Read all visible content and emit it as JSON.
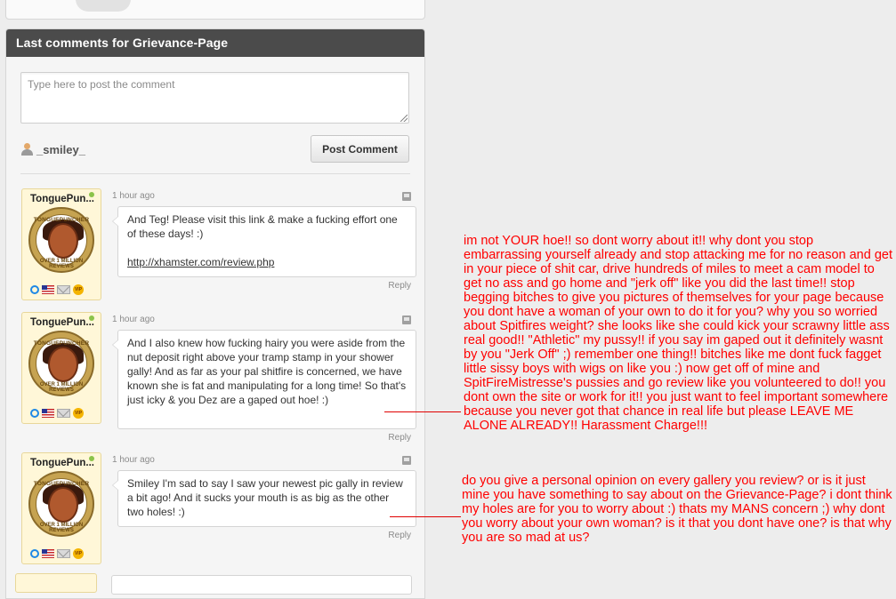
{
  "panel": {
    "title": "Last comments for Grievance-Page",
    "textarea_placeholder": "Type here to post the comment",
    "current_user": "_smiley_",
    "post_button": "Post Comment"
  },
  "badge": {
    "top_text": "TONGUEPUNCHER",
    "center_text": "XHAMSTER",
    "bottom_text": "OVER 1 MILLION REVIEWS",
    "vip_label": "VIP"
  },
  "comments": [
    {
      "username": "TonguePun...",
      "time": "1 hour ago",
      "text": "And Teg! Please visit this link & make a fucking effort one of these days! :)",
      "link": "http://xhamster.com/review.php",
      "reply": "Reply"
    },
    {
      "username": "TonguePun...",
      "time": "1 hour ago",
      "text": "And I also knew how fucking hairy you were aside from the nut deposit right above your tramp stamp in your shower gally! And as far as your pal shitfire is concerned, we have known she is fat and manipulating for a long time! So that's just icky & you Dez are a gaped out hoe! :)",
      "reply": "Reply"
    },
    {
      "username": "TonguePun...",
      "time": "1 hour ago",
      "text": "Smiley I'm sad to say I saw your newest pic gally in review a bit ago! And it sucks your mouth is as big as the other two holes! :)",
      "reply": "Reply"
    }
  ],
  "annotations": {
    "first": "im not YOUR hoe!! so dont worry about it!! why dont you stop embarrassing yourself already and stop attacking me for no reason and get in your piece of shit car, drive hundreds of miles to meet a cam model to get no ass and go home and \"jerk off\" like you did the last time!! stop begging bitches to give you pictures of themselves for your page because you dont have a woman of your own to do it for you? why you so worried about Spitfires weight? she looks like she could kick your scrawny little ass real good!! \"Athletic\" my pussy!! if you say im  gaped out it definitely  wasnt by you \"Jerk Off\"  ;) remember one thing!! bitches like me dont fuck fagget little sissy boys with wigs on like you :) now get off of mine and SpitFireMistresse's pussies and go review like you volunteered to do!! you dont own the site or work for it!! you just want to feel important somewhere because you never got that chance in real life but please LEAVE ME ALONE ALREADY!! Harassment Charge!!!",
    "second": "do you give a personal opinion on every gallery you review? or is it just mine you have something to say about on the Grievance-Page? i dont think my holes are for you to worry about :) thats my MANS concern ;) why dont you worry about your own woman? is it that you dont have one? is that why you are so mad at us?"
  },
  "colors": {
    "header_bg": "#4b4b4b",
    "annotation": "#ff0000",
    "avatar_bg": "#fff7d8"
  }
}
